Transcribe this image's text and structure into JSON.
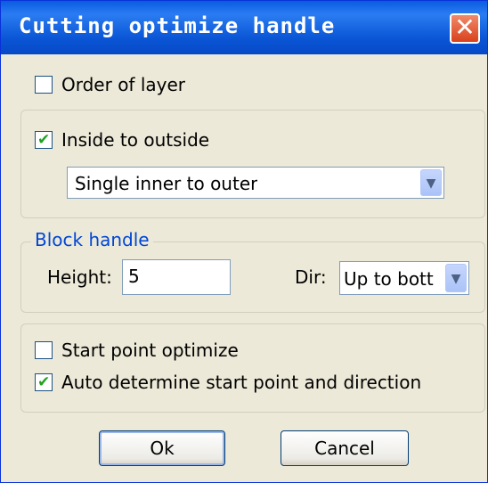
{
  "window": {
    "title": "Cutting optimize handle",
    "close_glyph": "✕"
  },
  "options": {
    "order_of_layer": {
      "label": "Order of layer",
      "checked": false
    },
    "inside_to_outside": {
      "label": "Inside to outside",
      "checked": true,
      "mode_value": "Single inner to outer"
    }
  },
  "block_handle": {
    "title": "Block handle",
    "height_label": "Height:",
    "height_value": "5",
    "dir_label": "Dir:",
    "dir_value": "Up to bott"
  },
  "start": {
    "start_point_optimize": {
      "label": "Start point optimize",
      "checked": false
    },
    "auto_determine": {
      "label": "Auto determine start point and direction",
      "checked": true
    }
  },
  "buttons": {
    "ok": "Ok",
    "cancel": "Cancel"
  },
  "glyphs": {
    "check": "✔",
    "dropdown": "▼"
  },
  "colors": {
    "title_bar": "#0a5be0",
    "dialog_bg": "#ece9d8",
    "group_title": "#0046d5",
    "check_tick": "#21a121"
  }
}
